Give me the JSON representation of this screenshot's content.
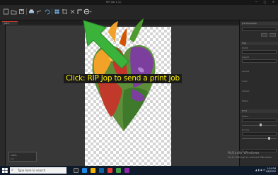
{
  "window": {
    "title": "RIP Job 1 (1)",
    "controls": [
      "—",
      "□",
      "✕"
    ]
  },
  "toolbar": {
    "tools": [
      "new-icon",
      "open-icon",
      "save-icon",
      "print-icon",
      "cut-icon",
      "undo-icon",
      "grid-icon",
      "crop-icon",
      "scissors-icon",
      "corner-icon",
      "rip-job-icon"
    ]
  },
  "tabs": [
    {
      "label": "Job 1"
    }
  ],
  "caption": {
    "text": "Click: RIP Jop to send a print job",
    "color": "#fff200"
  },
  "right_panel": {
    "sections": [
      "Job Properties",
      "Size",
      "Layout",
      "Color",
      "Output",
      "Media",
      "Print"
    ],
    "fields": [
      "Width",
      "Height",
      "Media",
      "Source"
    ]
  },
  "zoom_box": {
    "rows": [
      "100%",
      "1:1"
    ]
  },
  "activation": {
    "line1": "Activate Windows",
    "line2": "Go to Settings to activate Windows."
  },
  "taskbar": {
    "search_placeholder": "Type here to search",
    "time": "1:54 PM",
    "date": "4/8/2020",
    "colors": [
      "#1e88e5",
      "#f4b400",
      "#0a64a4",
      "#e53935",
      "#43a047",
      "#8e24aa"
    ]
  },
  "colors": {
    "accent_arrow": "#3bb33b",
    "caption_bg": "#1b1b1b",
    "workspace": "#383838"
  }
}
